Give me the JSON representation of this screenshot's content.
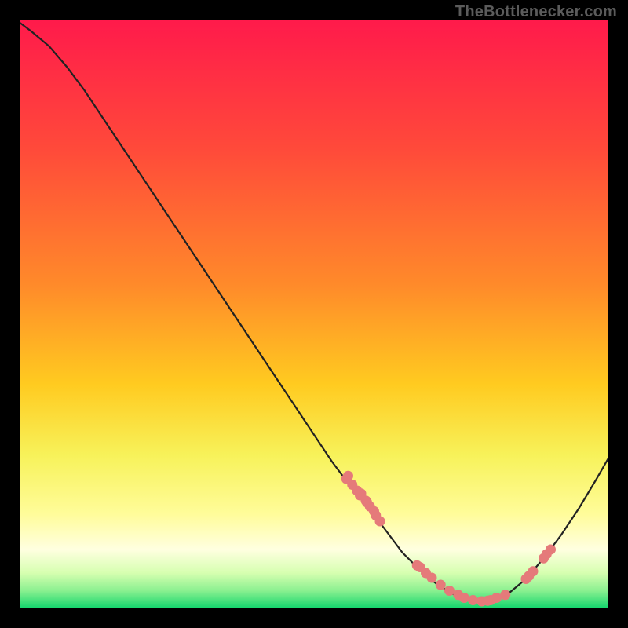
{
  "watermark": "TheBottlenecker.com",
  "chart_data": {
    "type": "line",
    "title": "",
    "xlabel": "",
    "ylabel": "",
    "xlim": [
      0,
      100
    ],
    "ylim": [
      0,
      100
    ],
    "gradient_top": "#ff1a4b",
    "gradient_bottom": "#12d66d",
    "band_top": "#f7f25a",
    "band_bottom": "#12d66d",
    "curve_x": [
      0,
      2,
      5,
      8,
      11,
      14,
      17,
      20,
      23,
      26,
      29,
      32,
      35,
      38,
      41,
      44,
      47,
      50,
      53,
      56,
      59,
      62,
      65,
      68,
      71,
      74,
      77,
      80,
      83,
      86,
      89,
      92,
      95,
      98,
      100
    ],
    "curve_y": [
      99.5,
      98.0,
      95.5,
      92.0,
      88.0,
      83.5,
      79.0,
      74.5,
      70.0,
      65.5,
      61.0,
      56.5,
      52.0,
      47.5,
      43.0,
      38.5,
      34.0,
      29.5,
      25.0,
      21.0,
      17.5,
      13.5,
      9.5,
      6.5,
      4.0,
      2.2,
      1.2,
      1.3,
      2.5,
      5.0,
      8.5,
      12.5,
      17.0,
      22.0,
      25.5
    ],
    "dots_x": [
      55.5,
      55.8,
      56.5,
      57.3,
      57.8,
      58.0,
      58.8,
      59.0,
      59.5,
      60.2,
      60.5,
      61.2,
      67.5,
      68.0,
      69.0,
      70.0,
      71.5,
      73.0,
      74.5,
      75.5,
      77.0,
      78.5,
      79.5,
      80.0,
      81.0,
      82.5,
      86.0,
      86.5,
      87.2,
      89.0,
      89.5,
      90.2
    ],
    "dots_y": [
      22.0,
      22.5,
      21.0,
      20.0,
      19.2,
      19.5,
      18.3,
      18.0,
      17.3,
      16.5,
      15.8,
      14.8,
      7.3,
      7.0,
      6.0,
      5.2,
      4.0,
      3.0,
      2.3,
      1.8,
      1.4,
      1.2,
      1.3,
      1.4,
      1.8,
      2.3,
      5.0,
      5.5,
      6.3,
      8.5,
      9.2,
      10.0
    ],
    "dot_color": "#e57a7a",
    "curve_color": "#222222"
  }
}
